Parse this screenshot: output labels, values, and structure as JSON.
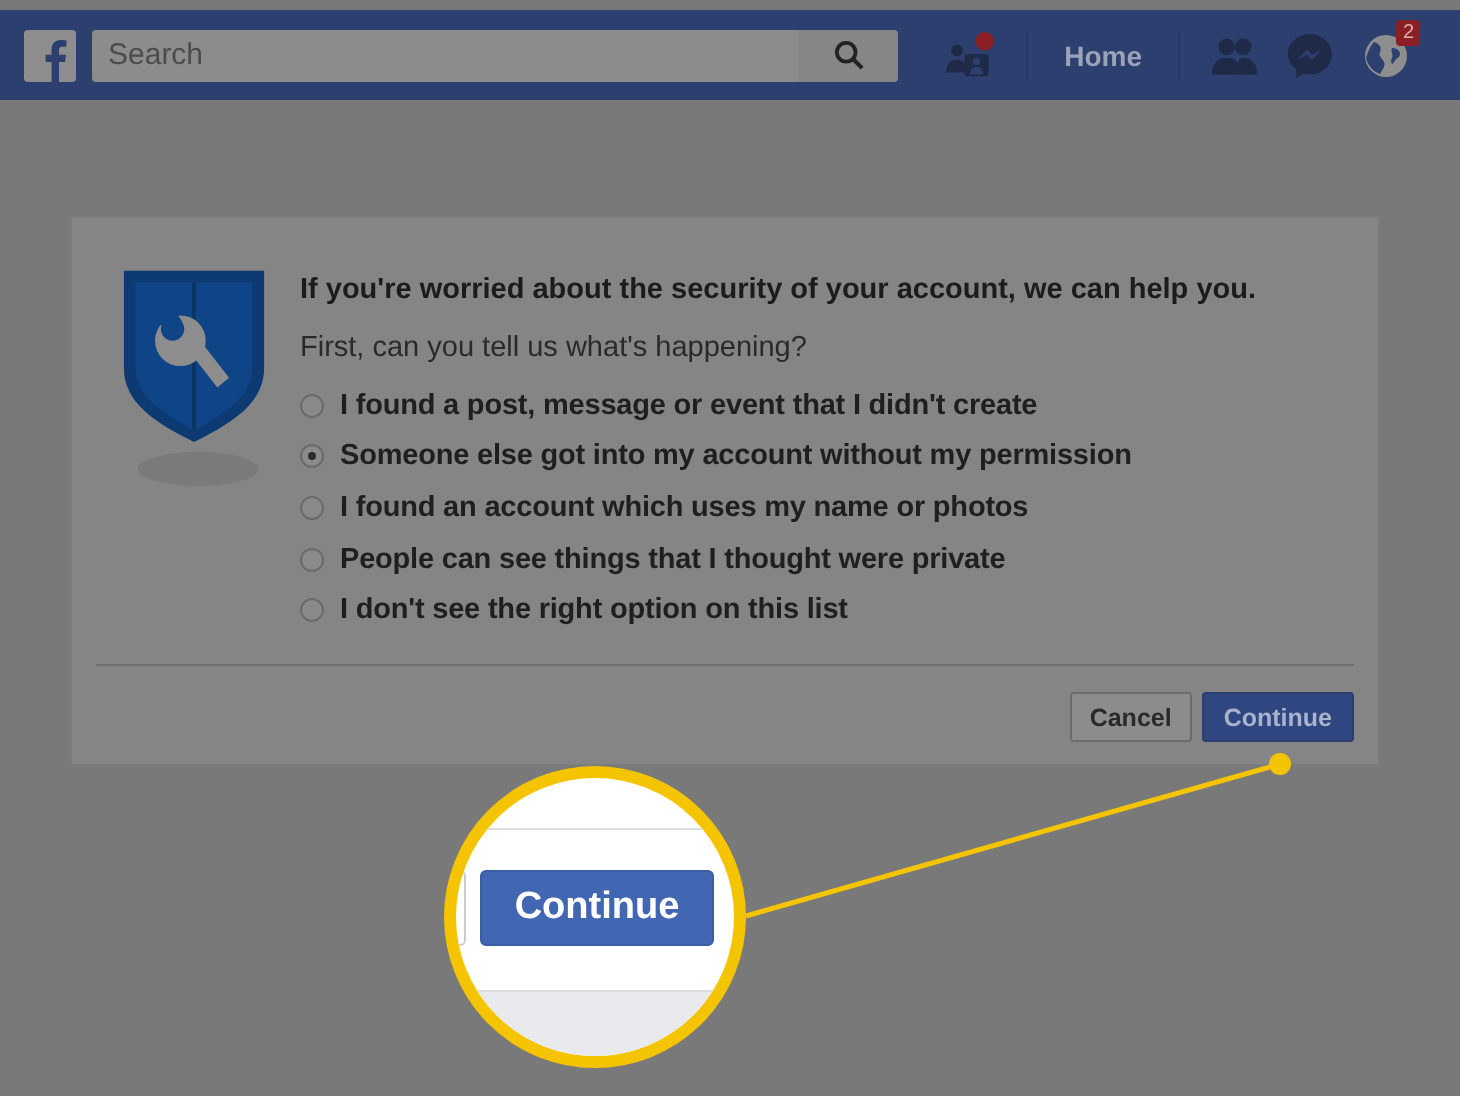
{
  "top_bar": {
    "search": {
      "placeholder": "Search"
    },
    "home": "Home",
    "notification_count": "2"
  },
  "dialog": {
    "title": "If you're worried about the security of your account, we can help you.",
    "question": "First, can you tell us what's happening?",
    "options": [
      {
        "label": "I found a post, message or event that I didn't create",
        "selected": false
      },
      {
        "label": "Someone else got into my account without my permission",
        "selected": true
      },
      {
        "label": "I found an account which uses my name or photos",
        "selected": false
      },
      {
        "label": "People can see things that I thought were private",
        "selected": false
      },
      {
        "label": "I don't see the right option on this list",
        "selected": false
      }
    ],
    "buttons": [
      {
        "label": "Cancel",
        "kind": "secondary"
      },
      {
        "label": "Continue",
        "kind": "primary"
      }
    ]
  },
  "callout": {
    "button": "Continue"
  }
}
